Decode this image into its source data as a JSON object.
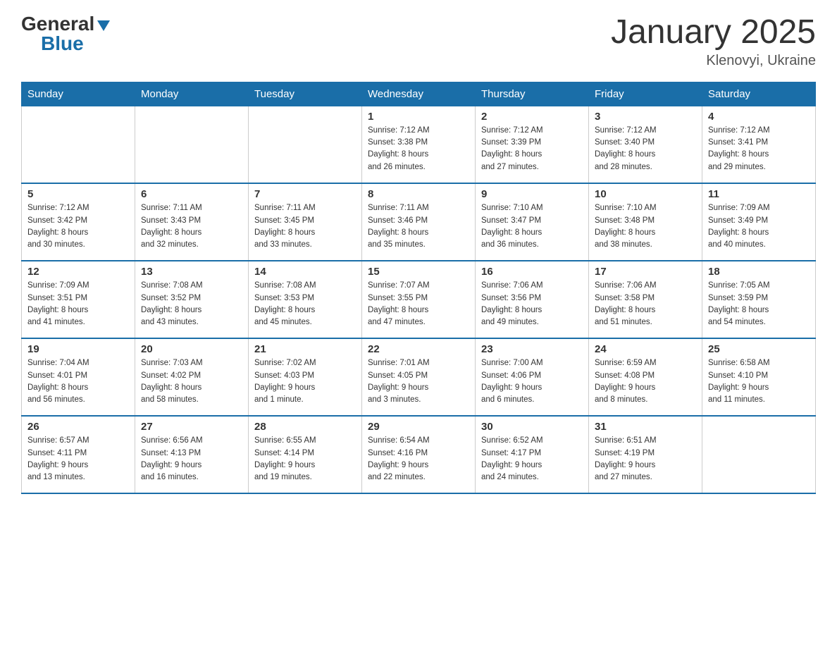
{
  "logo": {
    "general": "General",
    "blue": "Blue",
    "triangle": "▼"
  },
  "title": "January 2025",
  "location": "Klenovyi, Ukraine",
  "days_of_week": [
    "Sunday",
    "Monday",
    "Tuesday",
    "Wednesday",
    "Thursday",
    "Friday",
    "Saturday"
  ],
  "weeks": [
    [
      {
        "day": "",
        "info": ""
      },
      {
        "day": "",
        "info": ""
      },
      {
        "day": "",
        "info": ""
      },
      {
        "day": "1",
        "info": "Sunrise: 7:12 AM\nSunset: 3:38 PM\nDaylight: 8 hours\nand 26 minutes."
      },
      {
        "day": "2",
        "info": "Sunrise: 7:12 AM\nSunset: 3:39 PM\nDaylight: 8 hours\nand 27 minutes."
      },
      {
        "day": "3",
        "info": "Sunrise: 7:12 AM\nSunset: 3:40 PM\nDaylight: 8 hours\nand 28 minutes."
      },
      {
        "day": "4",
        "info": "Sunrise: 7:12 AM\nSunset: 3:41 PM\nDaylight: 8 hours\nand 29 minutes."
      }
    ],
    [
      {
        "day": "5",
        "info": "Sunrise: 7:12 AM\nSunset: 3:42 PM\nDaylight: 8 hours\nand 30 minutes."
      },
      {
        "day": "6",
        "info": "Sunrise: 7:11 AM\nSunset: 3:43 PM\nDaylight: 8 hours\nand 32 minutes."
      },
      {
        "day": "7",
        "info": "Sunrise: 7:11 AM\nSunset: 3:45 PM\nDaylight: 8 hours\nand 33 minutes."
      },
      {
        "day": "8",
        "info": "Sunrise: 7:11 AM\nSunset: 3:46 PM\nDaylight: 8 hours\nand 35 minutes."
      },
      {
        "day": "9",
        "info": "Sunrise: 7:10 AM\nSunset: 3:47 PM\nDaylight: 8 hours\nand 36 minutes."
      },
      {
        "day": "10",
        "info": "Sunrise: 7:10 AM\nSunset: 3:48 PM\nDaylight: 8 hours\nand 38 minutes."
      },
      {
        "day": "11",
        "info": "Sunrise: 7:09 AM\nSunset: 3:49 PM\nDaylight: 8 hours\nand 40 minutes."
      }
    ],
    [
      {
        "day": "12",
        "info": "Sunrise: 7:09 AM\nSunset: 3:51 PM\nDaylight: 8 hours\nand 41 minutes."
      },
      {
        "day": "13",
        "info": "Sunrise: 7:08 AM\nSunset: 3:52 PM\nDaylight: 8 hours\nand 43 minutes."
      },
      {
        "day": "14",
        "info": "Sunrise: 7:08 AM\nSunset: 3:53 PM\nDaylight: 8 hours\nand 45 minutes."
      },
      {
        "day": "15",
        "info": "Sunrise: 7:07 AM\nSunset: 3:55 PM\nDaylight: 8 hours\nand 47 minutes."
      },
      {
        "day": "16",
        "info": "Sunrise: 7:06 AM\nSunset: 3:56 PM\nDaylight: 8 hours\nand 49 minutes."
      },
      {
        "day": "17",
        "info": "Sunrise: 7:06 AM\nSunset: 3:58 PM\nDaylight: 8 hours\nand 51 minutes."
      },
      {
        "day": "18",
        "info": "Sunrise: 7:05 AM\nSunset: 3:59 PM\nDaylight: 8 hours\nand 54 minutes."
      }
    ],
    [
      {
        "day": "19",
        "info": "Sunrise: 7:04 AM\nSunset: 4:01 PM\nDaylight: 8 hours\nand 56 minutes."
      },
      {
        "day": "20",
        "info": "Sunrise: 7:03 AM\nSunset: 4:02 PM\nDaylight: 8 hours\nand 58 minutes."
      },
      {
        "day": "21",
        "info": "Sunrise: 7:02 AM\nSunset: 4:03 PM\nDaylight: 9 hours\nand 1 minute."
      },
      {
        "day": "22",
        "info": "Sunrise: 7:01 AM\nSunset: 4:05 PM\nDaylight: 9 hours\nand 3 minutes."
      },
      {
        "day": "23",
        "info": "Sunrise: 7:00 AM\nSunset: 4:06 PM\nDaylight: 9 hours\nand 6 minutes."
      },
      {
        "day": "24",
        "info": "Sunrise: 6:59 AM\nSunset: 4:08 PM\nDaylight: 9 hours\nand 8 minutes."
      },
      {
        "day": "25",
        "info": "Sunrise: 6:58 AM\nSunset: 4:10 PM\nDaylight: 9 hours\nand 11 minutes."
      }
    ],
    [
      {
        "day": "26",
        "info": "Sunrise: 6:57 AM\nSunset: 4:11 PM\nDaylight: 9 hours\nand 13 minutes."
      },
      {
        "day": "27",
        "info": "Sunrise: 6:56 AM\nSunset: 4:13 PM\nDaylight: 9 hours\nand 16 minutes."
      },
      {
        "day": "28",
        "info": "Sunrise: 6:55 AM\nSunset: 4:14 PM\nDaylight: 9 hours\nand 19 minutes."
      },
      {
        "day": "29",
        "info": "Sunrise: 6:54 AM\nSunset: 4:16 PM\nDaylight: 9 hours\nand 22 minutes."
      },
      {
        "day": "30",
        "info": "Sunrise: 6:52 AM\nSunset: 4:17 PM\nDaylight: 9 hours\nand 24 minutes."
      },
      {
        "day": "31",
        "info": "Sunrise: 6:51 AM\nSunset: 4:19 PM\nDaylight: 9 hours\nand 27 minutes."
      },
      {
        "day": "",
        "info": ""
      }
    ]
  ]
}
